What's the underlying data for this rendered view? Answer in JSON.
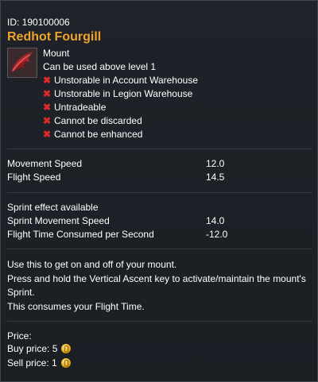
{
  "item": {
    "id_label": "ID: 190100006",
    "name": "Redhot Fourgill",
    "type": "Mount",
    "level_requirement": "Can be used above level 1",
    "icon": "red-wing-mount-icon",
    "restrictions": [
      "Unstorable in Account Warehouse",
      "Unstorable in Legion Warehouse",
      "Untradeable",
      "Cannot be discarded",
      "Cannot be enhanced"
    ]
  },
  "stats": [
    {
      "label": "Movement Speed",
      "value": "12.0"
    },
    {
      "label": "Flight Speed",
      "value": "14.5"
    }
  ],
  "sprint": {
    "header": "Sprint effect available",
    "stats": [
      {
        "label": "Sprint Movement Speed",
        "value": "14.0"
      },
      {
        "label": "Flight Time Consumed per Second",
        "value": "-12.0"
      }
    ]
  },
  "description": [
    "Use this to get on and off of your mount.",
    "Press and hold the Vertical Ascent key to activate/maintain the mount's Sprint.",
    "This consumes your Flight Time."
  ],
  "price": {
    "header": "Price:",
    "buy": "Buy price: 5",
    "sell": "Sell price: 1",
    "icon": "gold-coin-icon"
  },
  "colors": {
    "title": "#f0a32a",
    "restriction_mark": "#e02a2a",
    "background": "#1b1e23"
  }
}
